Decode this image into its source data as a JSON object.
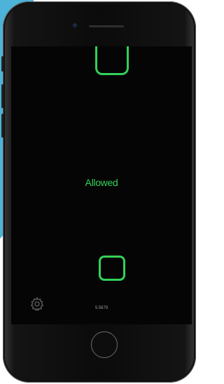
{
  "screen": {
    "status_text": "Allowed",
    "footer_number": "5.5679"
  },
  "icons": {
    "settings": "gear-icon",
    "top_shape": "u-shape-icon",
    "bottom_shape": "rounded-square-icon"
  },
  "colors": {
    "background_accent": "#4db3d8",
    "accent_green": "#34d058",
    "screen_bg": "#050505"
  }
}
